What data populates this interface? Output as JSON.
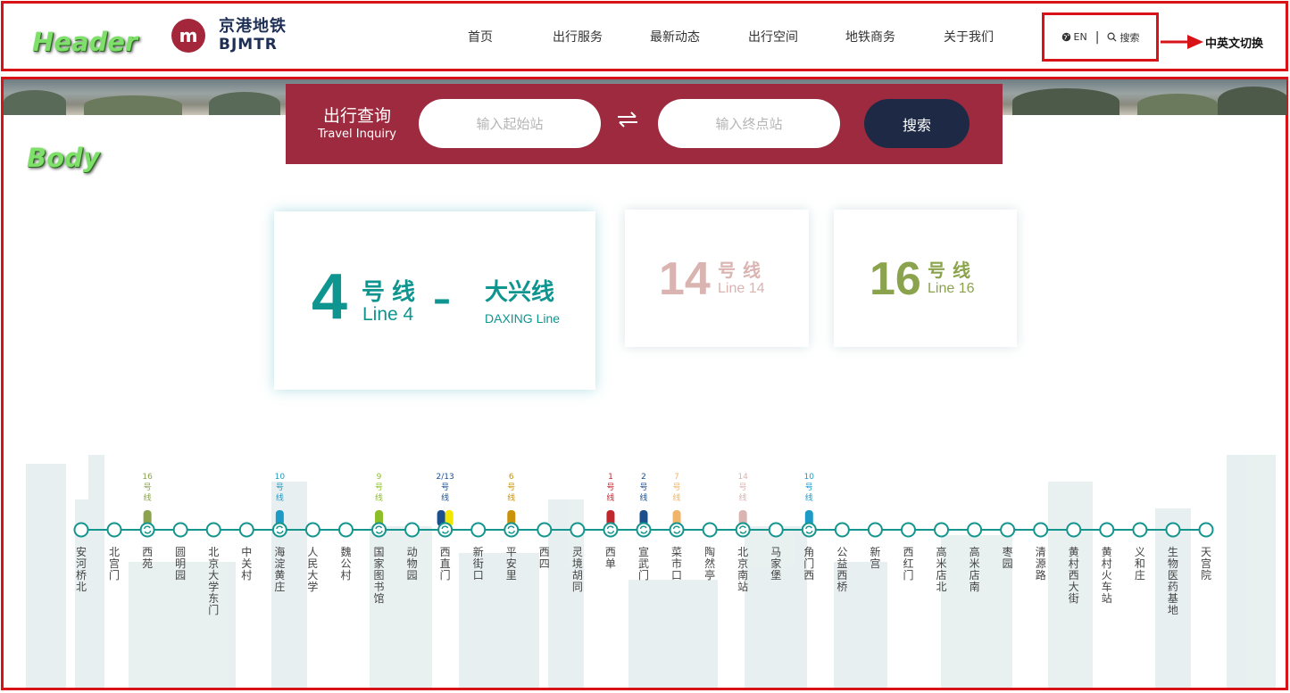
{
  "annotations": {
    "header": "Header",
    "body": "Body",
    "lang_switch": "中英文切换"
  },
  "brand": {
    "name_cn": "京港地铁",
    "name_en": "BJMTR",
    "accent": "#a3263a",
    "navy": "#1e2f55"
  },
  "nav": [
    {
      "label": "首页"
    },
    {
      "label": "出行服务"
    },
    {
      "label": "最新动态"
    },
    {
      "label": "出行空间"
    },
    {
      "label": "地铁商务"
    },
    {
      "label": "关于我们"
    }
  ],
  "toolbar": {
    "lang_icon": "globe-icon",
    "lang_label": "EN",
    "search_icon": "search-icon",
    "search_label": "搜索"
  },
  "inquiry": {
    "title_cn": "出行查询",
    "title_en": "Travel Inquiry",
    "from_placeholder": "输入起始站",
    "to_placeholder": "输入终点站",
    "swap_icon": "swap-arrows-icon",
    "button_label": "搜索",
    "bg_color": "#9d2a3e",
    "button_color": "#1e2a45"
  },
  "lines": {
    "line4": {
      "number": "4",
      "hao": "号线",
      "en": "Line 4",
      "dash": "–",
      "daxing_cn": "大兴线",
      "daxing_en": "DAXING Line",
      "color": "#0f958f"
    },
    "line14": {
      "number": "14",
      "hao": "号线",
      "en": "Line 14",
      "color": "#d9b4b1"
    },
    "line16": {
      "number": "16",
      "hao": "号线",
      "en": "Line 16",
      "color": "#8aa34c"
    }
  },
  "stations": [
    {
      "name": "安河桥北"
    },
    {
      "name": "北宫门"
    },
    {
      "name": "西苑",
      "transfer": "16号线",
      "colors": [
        "#8aa34c"
      ]
    },
    {
      "name": "圆明园"
    },
    {
      "name": "北京大学东门"
    },
    {
      "name": "中关村"
    },
    {
      "name": "海淀黄庄",
      "transfer": "10号线",
      "colors": [
        "#1e9ac7"
      ]
    },
    {
      "name": "人民大学"
    },
    {
      "name": "魏公村"
    },
    {
      "name": "国家图书馆",
      "transfer": "9号线",
      "colors": [
        "#8cbe28"
      ]
    },
    {
      "name": "动物园"
    },
    {
      "name": "西直门",
      "transfer": "2/13号线",
      "colors": [
        "#1c4f8c",
        "#f2e600"
      ]
    },
    {
      "name": "新街口"
    },
    {
      "name": "平安里",
      "transfer": "6号线",
      "colors": [
        "#c99208"
      ]
    },
    {
      "name": "西四"
    },
    {
      "name": "灵境胡同"
    },
    {
      "name": "西单",
      "transfer": "1号线",
      "colors": [
        "#c0272d"
      ]
    },
    {
      "name": "宣武门",
      "transfer": "2号线",
      "colors": [
        "#1c4f8c"
      ]
    },
    {
      "name": "菜市口",
      "transfer": "7号线",
      "colors": [
        "#f0b56b"
      ]
    },
    {
      "name": "陶然亭"
    },
    {
      "name": "北京南站",
      "transfer": "14号线",
      "colors": [
        "#d9b4b1"
      ]
    },
    {
      "name": "马家堡"
    },
    {
      "name": "角门西",
      "transfer": "10号线",
      "colors": [
        "#1e9ac7"
      ]
    },
    {
      "name": "公益西桥"
    },
    {
      "name": "新宫"
    },
    {
      "name": "西红门"
    },
    {
      "name": "高米店北"
    },
    {
      "name": "高米店南"
    },
    {
      "name": "枣园"
    },
    {
      "name": "清源路"
    },
    {
      "name": "黄村西大街"
    },
    {
      "name": "黄村火车站"
    },
    {
      "name": "义和庄"
    },
    {
      "name": "生物医药基地"
    },
    {
      "name": "天宫院"
    }
  ],
  "line_color": "#14958e",
  "frame_color": "#d81318"
}
